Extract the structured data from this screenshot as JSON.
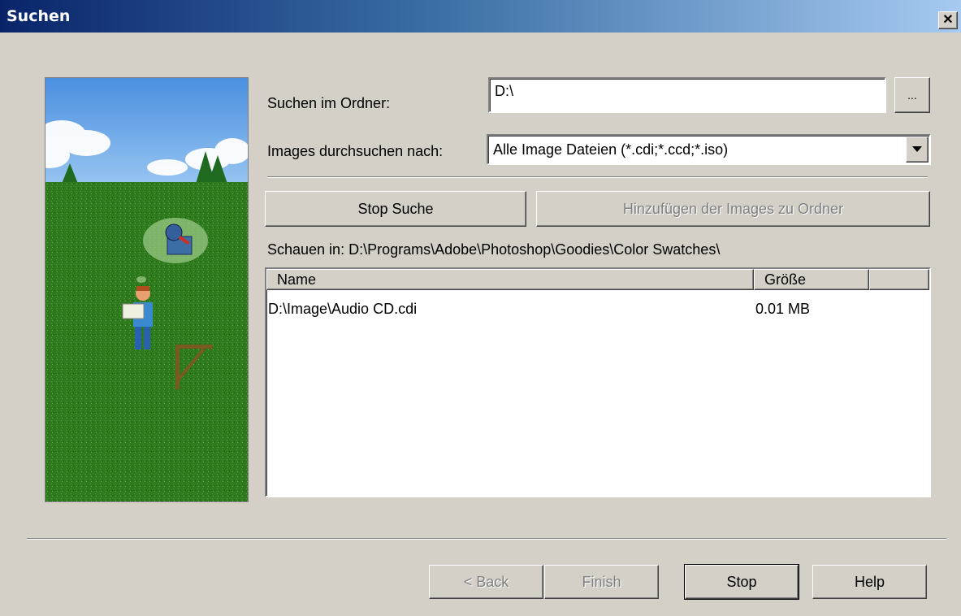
{
  "window": {
    "title": "Suchen",
    "close_icon": "✕"
  },
  "form": {
    "folder_label": "Suchen im Ordner:",
    "folder_value": "D:\\",
    "browse_label": "...",
    "type_label": "Images durchsuchen nach:",
    "type_value": "Alle Image Dateien (*.cdi;*.ccd;*.iso)",
    "stop_search_label": "Stop Suche",
    "add_images_label": "Hinzufügen der Images zu Ordner",
    "looking_in": "Schauen in: D:\\Programs\\Adobe\\Photoshop\\Goodies\\Color Swatches\\"
  },
  "results": {
    "columns": [
      "Name",
      "Größe",
      ""
    ],
    "rows": [
      {
        "name": "D:\\Image\\Audio CD.cdi",
        "size": "0.01 MB"
      }
    ]
  },
  "footer": {
    "back_label": "< Back",
    "finish_label": "Finish",
    "stop_label": "Stop",
    "help_label": "Help"
  },
  "colors": {
    "titlebar_start": "#0a246a",
    "titlebar_end": "#a6caf0",
    "face": "#d4d0c8",
    "grass": "#2e7a1e",
    "sky": "#5aa0e8"
  },
  "icons": {
    "dropdown": "chevron-down-icon",
    "wizard_image": "search-wizard-illustration"
  }
}
